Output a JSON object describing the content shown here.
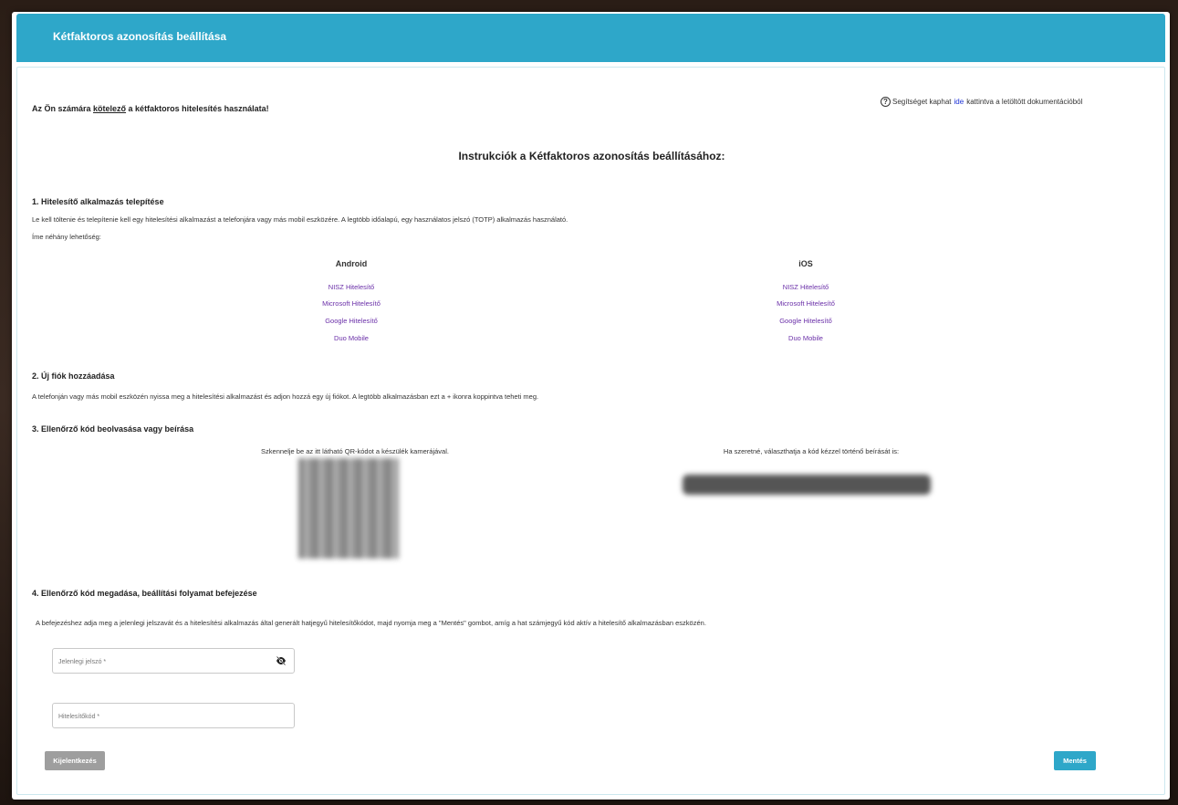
{
  "header": {
    "title": "Kétfaktoros azonosítás beállítása"
  },
  "notice": {
    "prefix": "Az Ön számára ",
    "emphasis": "kötelező",
    "suffix": " a kétfaktoros hitelesítés használata!"
  },
  "help": {
    "prefix": "Segítséget kaphat",
    "link": "ide",
    "suffix": "kattintva a letöltött dokumentációból"
  },
  "main_heading": "Instrukciók a Kétfaktoros azonosítás beállításához:",
  "step1": {
    "title": "1. Hitelesítő alkalmazás telepítése",
    "text1": "Le kell töltenie és telepítenie kell egy hitelesítési alkalmazást a telefonjára vagy más mobil eszközére. A legtöbb időalapú, egy használatos jelszó (TOTP) alkalmazás használató.",
    "text2": "Íme néhány lehetőség:",
    "android": {
      "heading": "Android",
      "links": [
        "NISZ Hitelesítő",
        "Microsoft Hitelesítő",
        "Google Hitelesítő",
        "Duo Mobile"
      ]
    },
    "ios": {
      "heading": "iOS",
      "links": [
        "NISZ Hitelesítő",
        "Microsoft Hitelesítő",
        "Google Hitelesítő",
        "Duo Mobile"
      ]
    }
  },
  "step2": {
    "title": "2. Új fiók hozzáadása",
    "text": "A telefonján vagy más mobil eszközén nyissa meg a hitelesítési alkalmazást és adjon hozzá egy új fiókot. A legtöbb alkalmazásban ezt a + ikonra koppintva teheti meg."
  },
  "step3": {
    "title": "3. Ellenőrző kód beolvasása vagy beírása",
    "scan_text": "Szkennelje be az itt látható QR-kódot a készülék kamerájával.",
    "manual_text": "Ha szeretné, választhatja a kód kézzel történő beírását is:"
  },
  "step4": {
    "title": "4. Ellenőrző kód megadása, beállítási folyamat befejezése",
    "text": "A befejezéshez adja meg a jelenlegi jelszavát és a hitelesítési alkalmazás által generált hatjegyű hitelesítőkódot, majd nyomja meg a \"Mentés\" gombot, amíg a hat számjegyű kód aktív a hitelesítő alkalmazásban eszközén."
  },
  "form": {
    "password_placeholder": "Jelenlegi jelszó *",
    "code_placeholder": "Hitelesítőkód *"
  },
  "buttons": {
    "logout": "Kijelentkezés",
    "save": "Mentés"
  },
  "colors": {
    "accent": "#2ea7c9",
    "link": "#6a2fa8",
    "secondary_button": "#9e9e9e"
  }
}
